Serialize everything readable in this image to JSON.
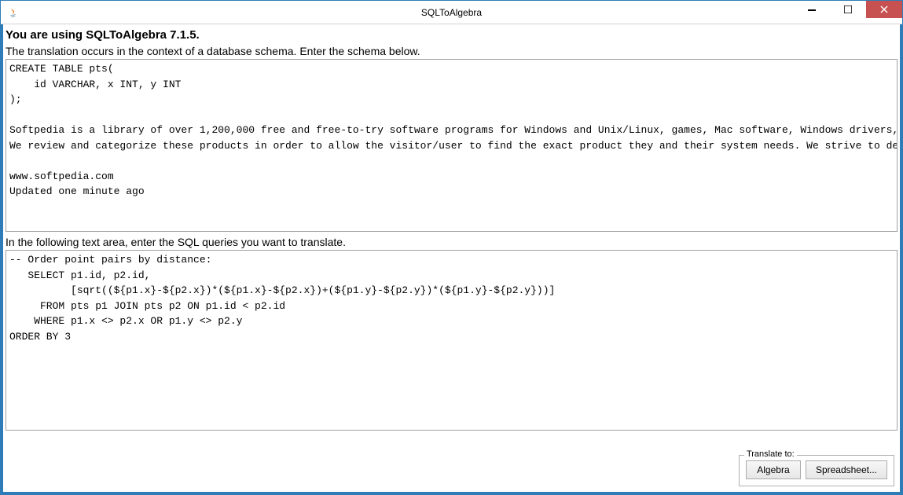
{
  "window": {
    "title": "SQLToAlgebra"
  },
  "heading": "You are using SQLToAlgebra 7.1.5.",
  "schema": {
    "label": "The translation occurs in the context of a database schema. Enter the schema below.",
    "value": "CREATE TABLE pts(\n    id VARCHAR, x INT, y INT\n);\n\nSoftpedia is a library of over 1,200,000 free and free-to-try software programs for Windows and Unix/Linux, games, Mac software, Windows drivers, mobile devices and IT-related articles.\nWe review and categorize these products in order to allow the visitor/user to find the exact product they and their system needs. We strive to deliver only the best products to the visitor/user together with self-made evaluation and review notes.\n\nwww.softpedia.com\nUpdated one minute ago"
  },
  "query": {
    "label": "In the following text area, enter the SQL queries you want to translate.",
    "value": "-- Order point pairs by distance:\n   SELECT p1.id, p2.id,\n          [sqrt((${p1.x}-${p2.x})*(${p1.x}-${p2.x})+(${p1.y}-${p2.y})*(${p1.y}-${p2.y}))]\n     FROM pts p1 JOIN pts p2 ON p1.id < p2.id\n    WHERE p1.x <> p2.x OR p1.y <> p2.y\nORDER BY 3"
  },
  "translate": {
    "legend": "Translate to:",
    "algebra": "Algebra",
    "spreadsheet": "Spreadsheet..."
  }
}
